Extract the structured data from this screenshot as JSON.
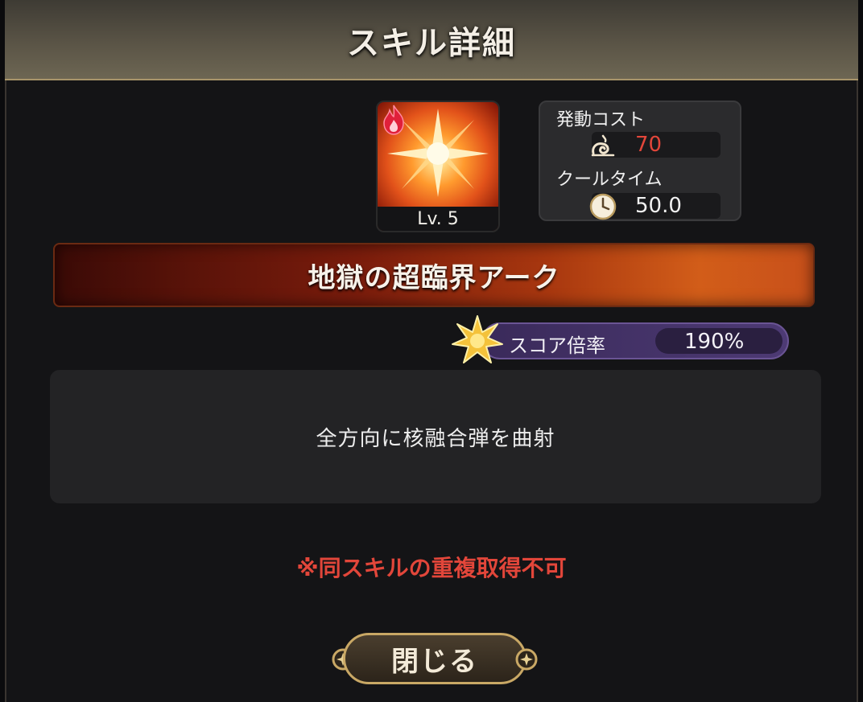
{
  "dialog": {
    "title": "スキル詳細"
  },
  "skill": {
    "icon": "starburst-icon",
    "element_icon": "fire-icon",
    "level": "Lv. 5",
    "name": "地獄の超臨界アーク",
    "description": "全方向に核融合弾を曲射",
    "note": "※同スキルの重複取得不可"
  },
  "stats": {
    "cost_label": "発動コスト",
    "cost_icon": "swirl-icon",
    "cost_value": "70",
    "cooldown_label": "クールタイム",
    "cooldown_icon": "clock-icon",
    "cooldown_value": "50.0"
  },
  "score": {
    "icon": "star-icon",
    "label": "スコア倍率",
    "value": "190%"
  },
  "buttons": {
    "close_label": "閉じる"
  },
  "colors": {
    "cost_value": "#e2463a",
    "note": "#e2463a",
    "accent_gold": "#c9a865",
    "score_purple": "#4d3a74"
  }
}
